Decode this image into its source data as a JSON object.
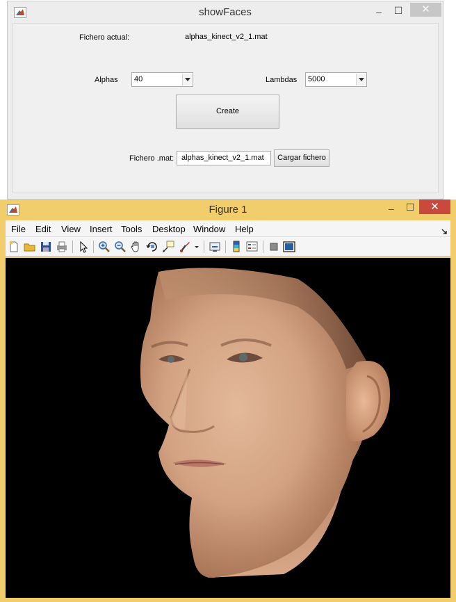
{
  "show_faces": {
    "title": "showFaces",
    "minimize": "‒",
    "maximize": "☐",
    "close": "✕",
    "current_file_label": "Fichero actual:",
    "current_file_value": "alphas_kinect_v2_1.mat",
    "alphas_label": "Alphas",
    "alphas_value": "40",
    "lambdas_label": "Lambdas",
    "lambdas_value": "5000",
    "create_label": "Create",
    "mat_file_label": "Fichero .mat:",
    "mat_file_value": "alphas_kinect_v2_1.mat",
    "load_button_label": "Cargar fichero"
  },
  "figure": {
    "title": "Figure 1",
    "minimize": "‒",
    "maximize": "☐",
    "close": "✕",
    "menus": [
      "File",
      "Edit",
      "View",
      "Insert",
      "Tools",
      "Desktop",
      "Window",
      "Help"
    ],
    "toolbar_icons": [
      "new-figure-icon",
      "open-file-icon",
      "save-icon",
      "print-icon",
      "edit-plot-icon",
      "zoom-in-icon",
      "zoom-out-icon",
      "pan-icon",
      "rotate-3d-icon",
      "data-cursor-icon",
      "brush-icon",
      "link-plot-icon",
      "colorbar-icon",
      "legend-icon",
      "hide-plot-tools-icon",
      "show-plot-tools-icon"
    ],
    "colors": {
      "title_bar": "#f2cd6c",
      "close_button": "#c94a3c",
      "canvas": "#000000"
    }
  }
}
